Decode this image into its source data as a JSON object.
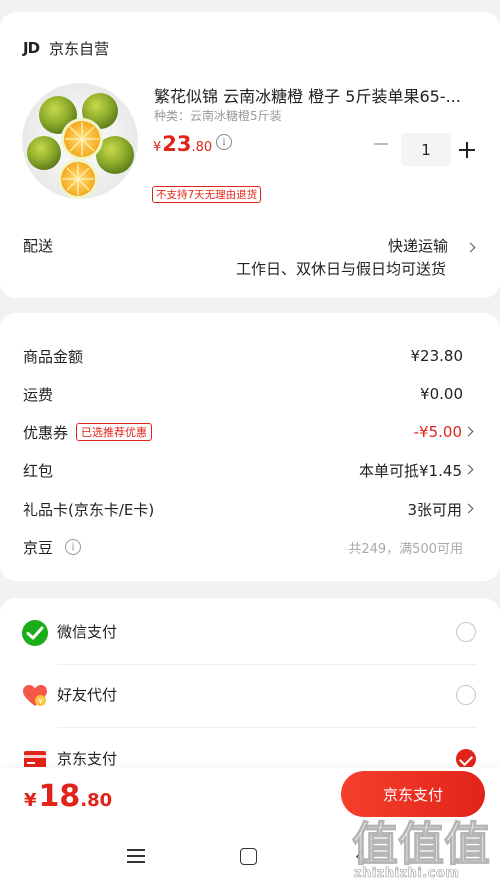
{
  "store": {
    "logo": "JD",
    "name": "京东自营"
  },
  "product": {
    "title": "繁花似锦 云南冰糖橙 橙子 5斤装单果65-...",
    "spec": "种类：云南冰糖橙5斤装",
    "price_currency": "¥",
    "price_int": "23",
    "price_dec": ".80",
    "quantity": "1",
    "return_policy": "不支持7天无理由退货"
  },
  "delivery": {
    "label": "配送",
    "method": "快递运输",
    "time": "工作日、双休日与假日均可送货"
  },
  "amounts": {
    "goods_label": "商品金额",
    "goods_value": "¥23.80",
    "shipping_label": "运费",
    "shipping_value": "¥0.00",
    "coupon_label": "优惠券",
    "coupon_tag": "已选推荐优惠",
    "coupon_value": "-¥5.00",
    "redpacket_label": "红包",
    "redpacket_value": "本单可抵¥1.45",
    "giftcard_label": "礼品卡(京东卡/E卡)",
    "giftcard_value": "3张可用",
    "jdbean_label": "京豆",
    "jdbean_value": "共249，满500可用"
  },
  "payment": {
    "options": [
      {
        "label": "微信支付",
        "icon": "wechat-pay-icon",
        "selected": false
      },
      {
        "label": "好友代付",
        "icon": "friend-pay-icon",
        "selected": false
      },
      {
        "label": "京东支付",
        "icon": "jd-pay-icon",
        "selected": true
      }
    ]
  },
  "footer": {
    "total_currency": "¥",
    "total_int": "18",
    "total_dec": ".80",
    "pay_button": "京东支付"
  },
  "watermark": {
    "chars": "值值值",
    "url": "zhizhizhi.com"
  },
  "colors": {
    "accent": "#e2231a",
    "wechat": "#1aad19"
  }
}
